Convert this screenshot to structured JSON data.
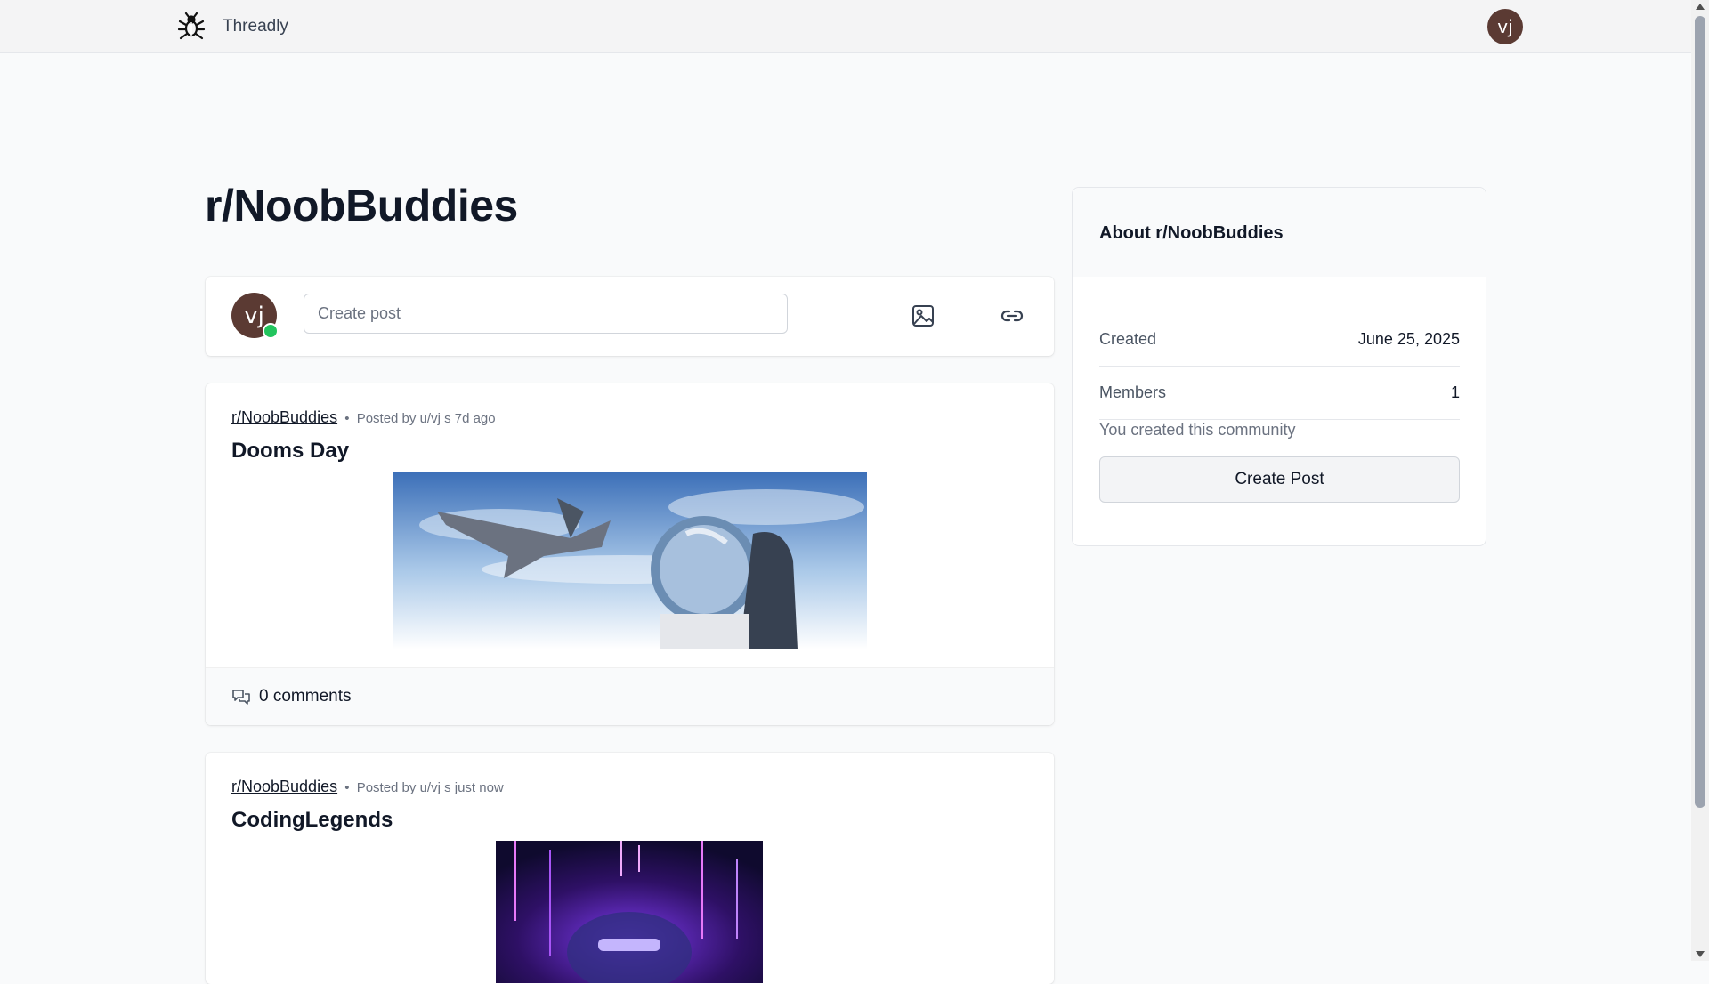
{
  "header": {
    "brand": "Threadly",
    "logo_icon": "bug-icon",
    "avatar_initials": "vj"
  },
  "community": {
    "title": "r/NoobBuddies"
  },
  "composer": {
    "avatar_initials": "vj",
    "placeholder": "Create post",
    "image_icon": "image-icon",
    "link_icon": "link-icon"
  },
  "posts": [
    {
      "subreddit": "r/NoobBuddies",
      "separator": "•",
      "meta": "Posted by u/vj s 7d ago",
      "title": "Dooms Day",
      "comments": "0 comments"
    },
    {
      "subreddit": "r/NoobBuddies",
      "separator": "•",
      "meta": "Posted by u/vj s just now",
      "title": "CodingLegends"
    }
  ],
  "sidebar": {
    "title": "About r/NoobBuddies",
    "created_label": "Created",
    "created_value": "June 25, 2025",
    "members_label": "Members",
    "members_value": "1",
    "note": "You created this community",
    "button_label": "Create Post"
  },
  "colors": {
    "avatar_bg": "#5b3a33",
    "online": "#22c55e",
    "accent_text": "#111827"
  }
}
